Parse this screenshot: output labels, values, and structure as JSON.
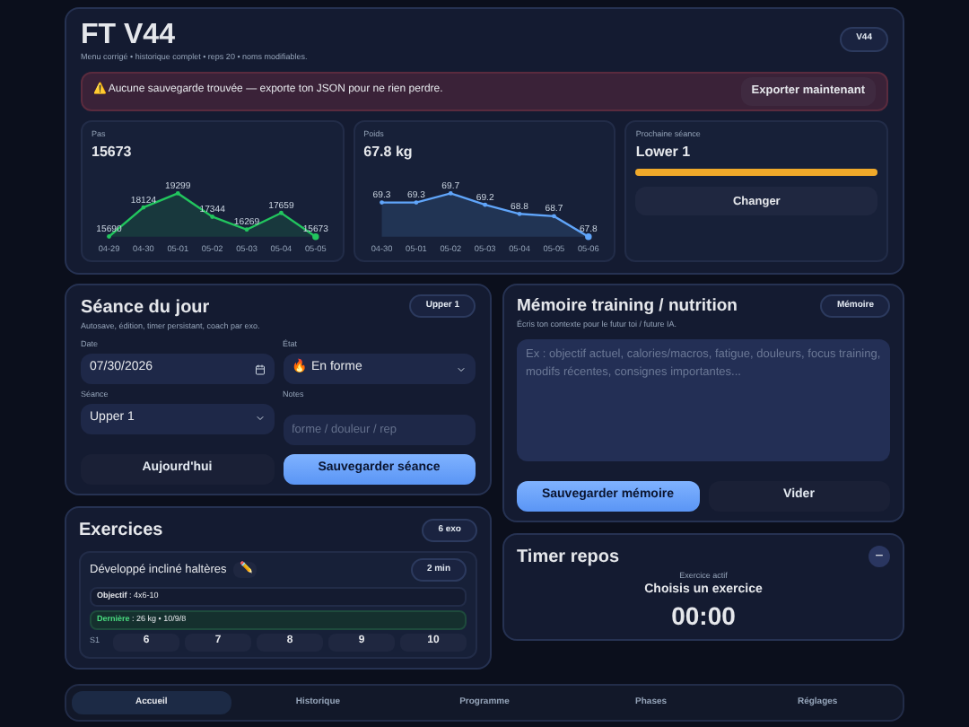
{
  "header": {
    "title": "FT V44",
    "subtitle": "Menu corrigé • historique complet • reps 20 • noms modifiables.",
    "badge": "V44"
  },
  "alert": {
    "icon": "⚠️",
    "text": "Aucune sauvegarde trouvée — exporte ton JSON pour ne rien perdre.",
    "button": "Exporter maintenant"
  },
  "stats": [
    {
      "label": "Pas",
      "value": "15673",
      "chart_data": {
        "type": "area",
        "categories": [
          "04-29",
          "04-30",
          "05-01",
          "05-02",
          "05-03",
          "05-04",
          "05-05"
        ],
        "series": [
          {
            "color": "#22c55e",
            "values": [
              15690,
              18124,
              19299,
              17344,
              16269,
              17659,
              15673
            ]
          }
        ],
        "data_labels": true
      }
    },
    {
      "label": "Poids",
      "value": "67.8 kg",
      "chart_data": {
        "type": "area",
        "categories": [
          "04-30",
          "05-01",
          "05-02",
          "05-03",
          "05-04",
          "05-05",
          "05-06"
        ],
        "series": [
          {
            "color": "#60a5fa",
            "values": [
              69.3,
              69.3,
              69.7,
              69.2,
              68.8,
              68.7,
              67.8
            ]
          }
        ],
        "data_labels": true
      }
    }
  ],
  "next_session": {
    "label": "Prochaine séance",
    "value": "Lower 1",
    "level": 1,
    "button": "Changer"
  },
  "session": {
    "title": "Séance du jour",
    "subtitle": "Autosave, édition, timer persistant, coach par exo.",
    "badge": "Upper 1",
    "fields": [
      {
        "label": "Date",
        "kind": "date",
        "value": "07/30/2026"
      },
      {
        "label": "État",
        "kind": "select",
        "icon": "🔥",
        "value": "En forme"
      },
      {
        "label": "Séance",
        "kind": "select",
        "value": "Upper 1"
      },
      {
        "label": "Notes",
        "kind": "text",
        "placeholder": "forme / douleur / rep"
      }
    ],
    "buttons": [
      {
        "label": "Aujourd'hui",
        "primary": false
      },
      {
        "label": "Sauvegarder séance",
        "primary": true
      }
    ]
  },
  "memory": {
    "title": "Mémoire training / nutrition",
    "subtitle": "Écris ton contexte pour le futur toi / future IA.",
    "badge": "Mémoire",
    "placeholder": "Ex : objectif actuel, calories/macros, fatigue, douleurs, focus training, modifs récentes, consignes importantes...",
    "buttons": [
      {
        "label": "Sauvegarder mémoire",
        "primary": true
      },
      {
        "label": "Vider",
        "primary": false
      }
    ]
  },
  "exercises": {
    "title": "Exercices",
    "badge": "6 exo",
    "exercise": {
      "name": "Développé incliné haltères",
      "icon": "✏️",
      "badge": "2 min",
      "objective_label": "Objectif",
      "objective": " : 4x6-10",
      "last_label": "Dernière",
      "last": " : 26 kg • 10/9/8",
      "set_label": "S1",
      "reps": [
        "6",
        "7",
        "8",
        "9",
        "10"
      ]
    }
  },
  "timer": {
    "title": "Timer repos",
    "toggle": "−",
    "label": "Exercice actif",
    "exercise": "Choisis un exercice",
    "time": "00:00"
  },
  "nav": [
    {
      "label": "Accueil",
      "selected": true
    },
    {
      "label": "Historique",
      "selected": false
    },
    {
      "label": "Programme",
      "selected": false
    },
    {
      "label": "Phases",
      "selected": false
    },
    {
      "label": "Réglages",
      "selected": false
    }
  ]
}
